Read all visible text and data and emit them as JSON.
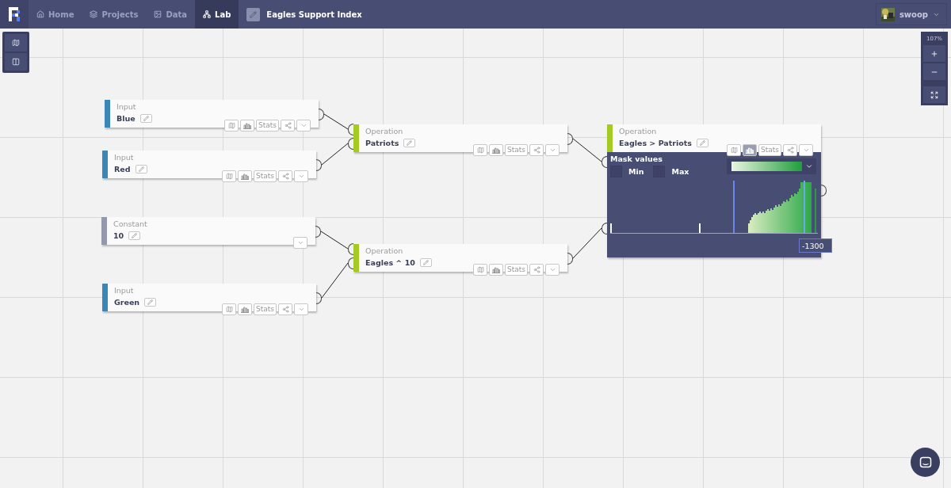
{
  "nav": {
    "items": [
      {
        "kind": "home",
        "label": "Home",
        "selected": false
      },
      {
        "kind": "projects",
        "label": "Projects",
        "selected": false
      },
      {
        "kind": "data",
        "label": "Data",
        "selected": false
      },
      {
        "kind": "lab",
        "label": "Lab",
        "selected": true
      }
    ],
    "project": {
      "title": "Eagles Support Index"
    },
    "user": {
      "name": "swoop"
    }
  },
  "zoom_panel": {
    "zoom_text": "107%"
  },
  "nodes": [
    {
      "kind": "input",
      "type_label": "Input",
      "name": "Blue",
      "stats_label": "Stats",
      "histogram_selected": false,
      "expanded": false
    },
    {
      "kind": "input",
      "type_label": "Input",
      "name": "Red",
      "stats_label": "Stats",
      "histogram_selected": false,
      "expanded": false
    },
    {
      "kind": "constant",
      "type_label": "Constant",
      "name": "10",
      "expanded": false
    },
    {
      "kind": "input",
      "type_label": "Input",
      "name": "Green",
      "stats_label": "Stats",
      "histogram_selected": false,
      "expanded": false
    },
    {
      "kind": "operation",
      "type_label": "Operation",
      "name": "Patriots",
      "stats_label": "Stats",
      "histogram_selected": false,
      "expanded": false
    },
    {
      "kind": "operation",
      "type_label": "Operation",
      "name": "Eagles ^ 10",
      "stats_label": "Stats",
      "histogram_selected": false,
      "expanded": false
    },
    {
      "kind": "operation",
      "type_label": "Operation",
      "name": "Eagles > Patriots",
      "stats_label": "Stats",
      "histogram_selected": true,
      "expanded": true,
      "panel": {
        "title": "Mask values",
        "min": {
          "label": "Min",
          "checked": false
        },
        "max": {
          "label": "Max",
          "checked": false
        },
        "value": "-1300"
      }
    }
  ]
}
